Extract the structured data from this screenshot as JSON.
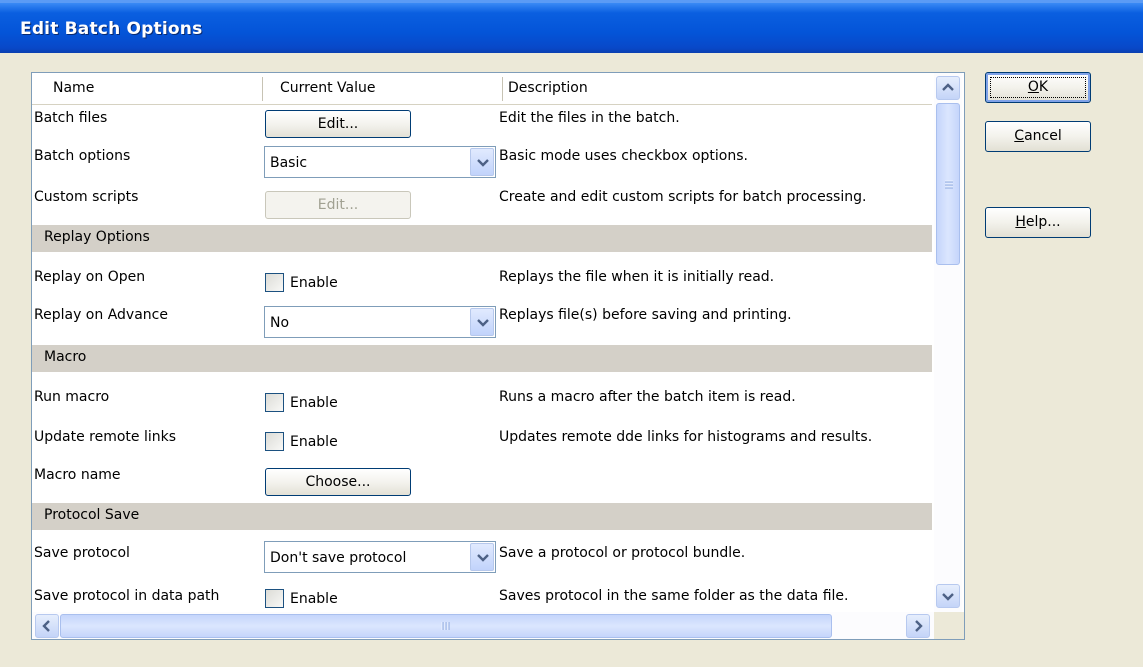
{
  "window": {
    "title": "Edit Batch Options"
  },
  "columns": {
    "name": "Name",
    "value": "Current Value",
    "description": "Description"
  },
  "rows": {
    "batch_files": {
      "name": "Batch files",
      "button": "Edit...",
      "description": "Edit the files in the batch."
    },
    "batch_options": {
      "name": "Batch options",
      "value": "Basic",
      "description": "Basic mode uses checkbox options."
    },
    "custom_scripts": {
      "name": "Custom scripts",
      "button": "Edit...",
      "description": "Create and edit custom scripts for batch processing."
    },
    "replay_on_open": {
      "name": "Replay on Open",
      "checkbox": "Enable",
      "description": "Replays the file when it is initially read."
    },
    "replay_on_advance": {
      "name": "Replay on Advance",
      "value": "No",
      "description": "Replays file(s) before saving and printing."
    },
    "run_macro": {
      "name": "Run macro",
      "checkbox": "Enable",
      "description": "Runs a macro after the batch item is read."
    },
    "update_remote_links": {
      "name": "Update remote links",
      "checkbox": "Enable",
      "description": "Updates remote dde links for histograms and results."
    },
    "macro_name": {
      "name": "Macro name",
      "button": "Choose...",
      "description": ""
    },
    "save_protocol": {
      "name": "Save protocol",
      "value": "Don't save protocol",
      "description": "Save a protocol or protocol bundle."
    },
    "save_protocol_data_path": {
      "name": "Save protocol in data path",
      "checkbox": "Enable",
      "description": "Saves protocol in the same folder as the data file."
    }
  },
  "sections": {
    "replay": "Replay Options",
    "macro": "Macro",
    "protocol": "Protocol Save"
  },
  "buttons": {
    "ok": {
      "mnemonic": "O",
      "rest": "K"
    },
    "cancel": {
      "mnemonic": "C",
      "rest": "ancel"
    },
    "help": {
      "mnemonic": "H",
      "rest": "elp..."
    }
  },
  "icons": {
    "scroll_up": "scroll-up-arrow-icon",
    "scroll_down": "scroll-down-arrow-icon",
    "scroll_left": "scroll-left-arrow-icon",
    "scroll_right": "scroll-right-arrow-icon",
    "dropdown": "chevron-down-icon"
  },
  "colors": {
    "title_bar": "#0454d8",
    "dialog_bg": "#ece9d8",
    "section_bg": "#d4d0c8",
    "border": "#7f9db9"
  }
}
